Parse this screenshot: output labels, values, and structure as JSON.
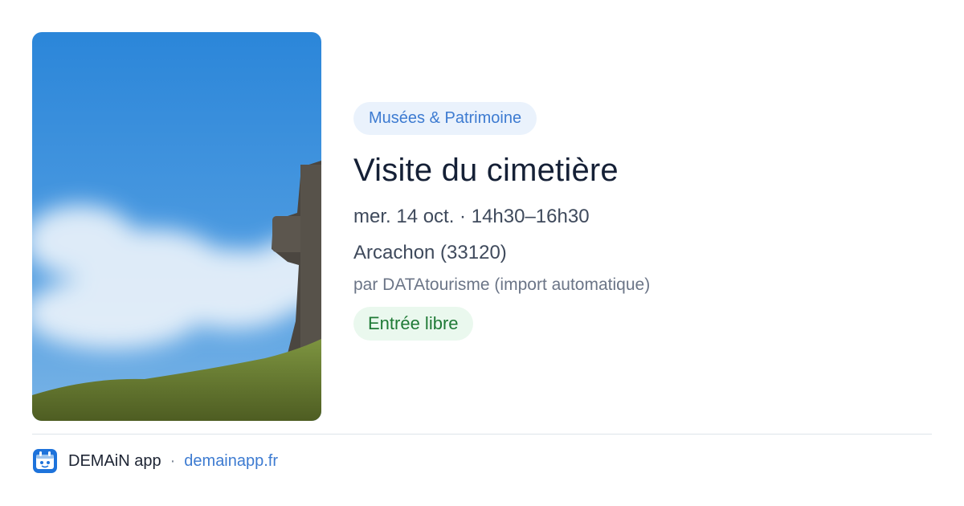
{
  "event": {
    "category": "Musées & Patrimoine",
    "title": "Visite du cimetière",
    "datetime": "mer. 14 oct. · 14h30–16h30",
    "location": "Arcachon (33120)",
    "organizer": "par DATAtourisme (import automatique)",
    "price": "Entrée libre"
  },
  "footer": {
    "brand": "DEMAiN app",
    "separator": "·",
    "website": "demainapp.fr",
    "logo_icon": "demain-app-logo-icon"
  },
  "colors": {
    "accent": "#3d7bd1",
    "category_bg": "#eaf2fc",
    "price_text": "#1f7a36",
    "price_bg": "#eaf8ee",
    "title": "#152036"
  }
}
